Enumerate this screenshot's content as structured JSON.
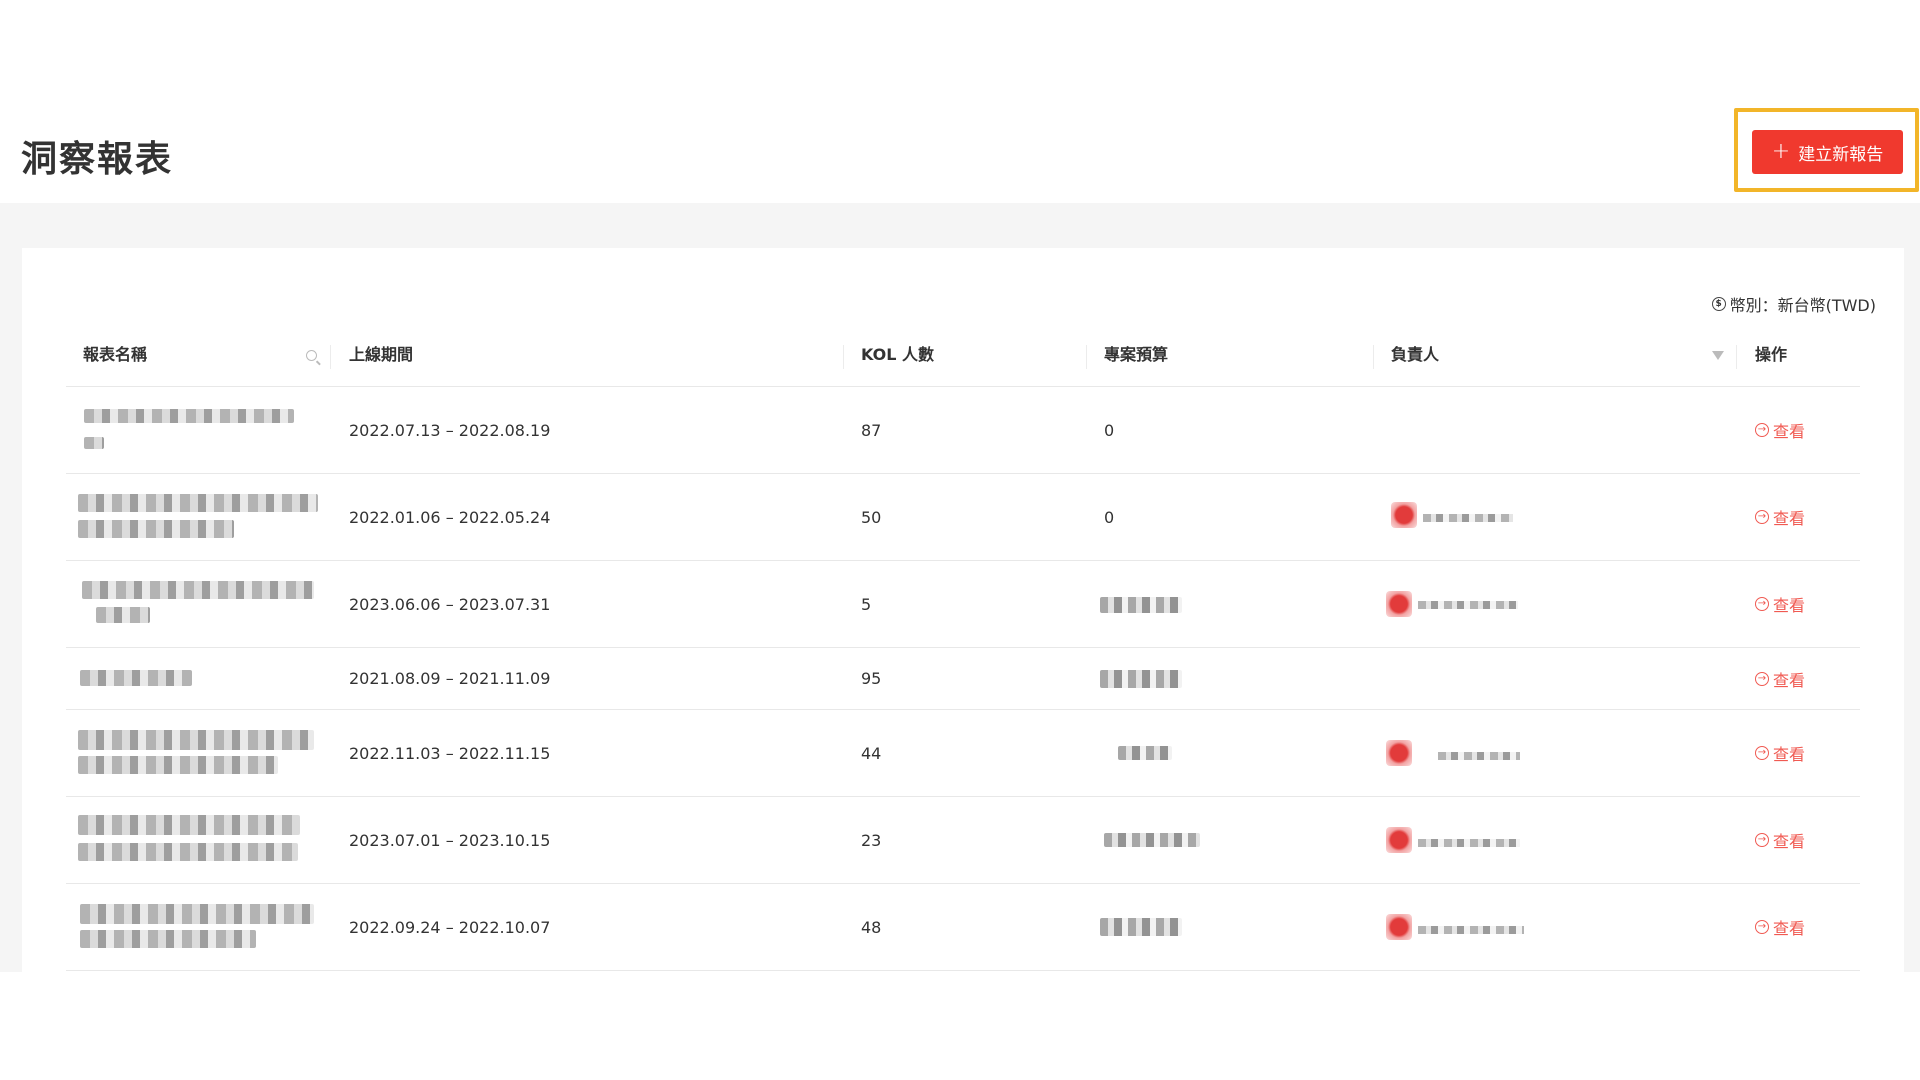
{
  "header": {
    "title": "洞察報表",
    "create_button_label": "建立新報告"
  },
  "currency_note": "幣別：新台幣(TWD)",
  "table": {
    "columns": [
      "報表名稱",
      "上線期間",
      "KOL 人數",
      "專案預算",
      "負責人",
      "操作"
    ],
    "rows": [
      {
        "period": "2022.07.13 – 2022.08.19",
        "kol": "87",
        "budget": "0",
        "action": "查看"
      },
      {
        "period": "2022.01.06 – 2022.05.24",
        "kol": "50",
        "budget": "0",
        "action": "查看"
      },
      {
        "period": "2023.06.06 – 2023.07.31",
        "kol": "5",
        "budget": "",
        "action": "查看"
      },
      {
        "period": "2021.08.09 – 2021.11.09",
        "kol": "95",
        "budget": "",
        "action": "查看"
      },
      {
        "period": "2022.11.03 – 2022.11.15",
        "kol": "44",
        "budget": "",
        "action": "查看"
      },
      {
        "period": "2023.07.01 – 2023.10.15",
        "kol": "23",
        "budget": "",
        "action": "查看"
      },
      {
        "period": "2022.09.24 – 2022.10.07",
        "kol": "48",
        "budget": "",
        "action": "查看"
      }
    ]
  },
  "colors": {
    "accent": "#f0392e",
    "highlight": "#f2b529",
    "link": "#f05a52"
  }
}
